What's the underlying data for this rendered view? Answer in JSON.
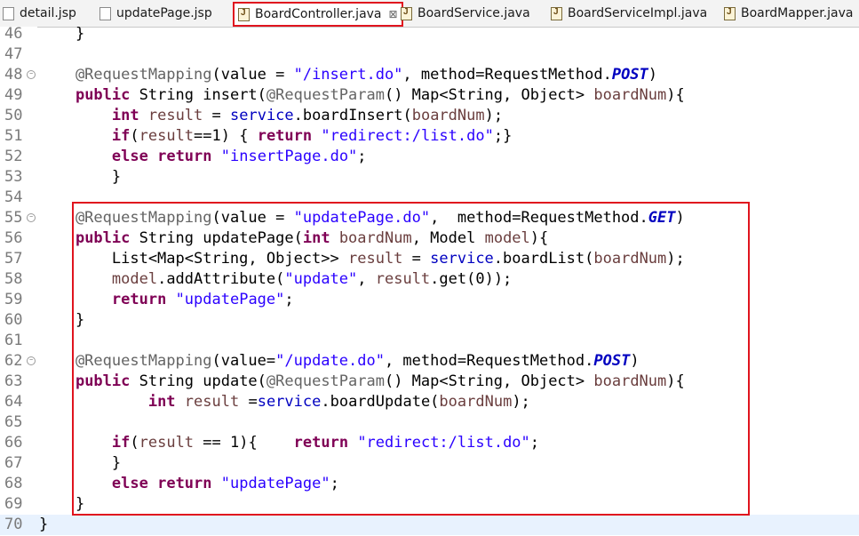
{
  "tabs": [
    {
      "label": "detail.jsp",
      "type": "jsp"
    },
    {
      "label": "updatePage.jsp",
      "type": "jsp"
    },
    {
      "label": "BoardController.java",
      "type": "java",
      "active": true,
      "close": "⊠"
    },
    {
      "label": "BoardService.java",
      "type": "java"
    },
    {
      "label": "BoardServiceImpl.java",
      "type": "java"
    },
    {
      "label": "BoardMapper.java",
      "type": "java"
    }
  ],
  "lines": [
    {
      "n": "46",
      "t": [
        [
          "    }",
          "p"
        ]
      ]
    },
    {
      "n": "47",
      "t": []
    },
    {
      "n": "48",
      "fold": true,
      "t": [
        [
          "    @RequestMapping",
          "ann"
        ],
        [
          "(value = ",
          "p"
        ],
        [
          "\"/insert.do\"",
          "str"
        ],
        [
          ", method=RequestMethod.",
          "p"
        ],
        [
          "POST",
          "cst"
        ],
        [
          ")",
          "p"
        ]
      ]
    },
    {
      "n": "49",
      "t": [
        [
          "    ",
          "p"
        ],
        [
          "public",
          "kw"
        ],
        [
          " String insert(",
          "p"
        ],
        [
          "@RequestParam",
          "ann"
        ],
        [
          "() Map<String, Object> ",
          "p"
        ],
        [
          "boardNum",
          "var"
        ],
        [
          "){",
          "p"
        ]
      ]
    },
    {
      "n": "50",
      "t": [
        [
          "        ",
          "p"
        ],
        [
          "int",
          "kw"
        ],
        [
          " ",
          "p"
        ],
        [
          "result",
          "var"
        ],
        [
          " = ",
          "p"
        ],
        [
          "service",
          "fld"
        ],
        [
          ".boardInsert(",
          "p"
        ],
        [
          "boardNum",
          "var"
        ],
        [
          ");",
          "p"
        ]
      ]
    },
    {
      "n": "51",
      "t": [
        [
          "        ",
          "p"
        ],
        [
          "if",
          "kw"
        ],
        [
          "(",
          "p"
        ],
        [
          "result",
          "var"
        ],
        [
          "==1) { ",
          "p"
        ],
        [
          "return",
          "kw"
        ],
        [
          " ",
          "p"
        ],
        [
          "\"redirect:/list.do\"",
          "str"
        ],
        [
          ";}",
          "p"
        ]
      ]
    },
    {
      "n": "52",
      "t": [
        [
          "        ",
          "p"
        ],
        [
          "else",
          "kw"
        ],
        [
          " ",
          "p"
        ],
        [
          "return",
          "kw"
        ],
        [
          " ",
          "p"
        ],
        [
          "\"insertPage.do\"",
          "str"
        ],
        [
          ";",
          "p"
        ]
      ]
    },
    {
      "n": "53",
      "t": [
        [
          "        }",
          "p"
        ]
      ]
    },
    {
      "n": "54",
      "t": []
    },
    {
      "n": "55",
      "fold": true,
      "t": [
        [
          "    @RequestMapping",
          "ann"
        ],
        [
          "(value = ",
          "p"
        ],
        [
          "\"updatePage.do\"",
          "str"
        ],
        [
          ",  method=RequestMethod.",
          "p"
        ],
        [
          "GET",
          "cst"
        ],
        [
          ")",
          "p"
        ]
      ]
    },
    {
      "n": "56",
      "t": [
        [
          "    ",
          "p"
        ],
        [
          "public",
          "kw"
        ],
        [
          " String updatePage(",
          "p"
        ],
        [
          "int",
          "kw"
        ],
        [
          " ",
          "p"
        ],
        [
          "boardNum",
          "var"
        ],
        [
          ", Model ",
          "p"
        ],
        [
          "model",
          "var"
        ],
        [
          "){",
          "p"
        ]
      ]
    },
    {
      "n": "57",
      "t": [
        [
          "        List<Map<String, Object>> ",
          "p"
        ],
        [
          "result",
          "var"
        ],
        [
          " = ",
          "p"
        ],
        [
          "service",
          "fld"
        ],
        [
          ".boardList(",
          "p"
        ],
        [
          "boardNum",
          "var"
        ],
        [
          ");",
          "p"
        ]
      ]
    },
    {
      "n": "58",
      "t": [
        [
          "        ",
          "p"
        ],
        [
          "model",
          "var"
        ],
        [
          ".addAttribute(",
          "p"
        ],
        [
          "\"update\"",
          "str"
        ],
        [
          ", ",
          "p"
        ],
        [
          "result",
          "var"
        ],
        [
          ".get(0));",
          "p"
        ]
      ]
    },
    {
      "n": "59",
      "t": [
        [
          "        ",
          "p"
        ],
        [
          "return",
          "kw"
        ],
        [
          " ",
          "p"
        ],
        [
          "\"updatePage\"",
          "str"
        ],
        [
          ";",
          "p"
        ]
      ]
    },
    {
      "n": "60",
      "t": [
        [
          "    }",
          "p"
        ]
      ]
    },
    {
      "n": "61",
      "t": []
    },
    {
      "n": "62",
      "fold": true,
      "t": [
        [
          "    @RequestMapping",
          "ann"
        ],
        [
          "(value=",
          "p"
        ],
        [
          "\"/update.do\"",
          "str"
        ],
        [
          ", method=RequestMethod.",
          "p"
        ],
        [
          "POST",
          "cst"
        ],
        [
          ")",
          "p"
        ]
      ]
    },
    {
      "n": "63",
      "t": [
        [
          "    ",
          "p"
        ],
        [
          "public",
          "kw"
        ],
        [
          " String update(",
          "p"
        ],
        [
          "@RequestParam",
          "ann"
        ],
        [
          "() Map<String, Object> ",
          "p"
        ],
        [
          "boardNum",
          "var"
        ],
        [
          "){",
          "p"
        ]
      ]
    },
    {
      "n": "64",
      "t": [
        [
          "            ",
          "p"
        ],
        [
          "int",
          "kw"
        ],
        [
          " ",
          "p"
        ],
        [
          "result",
          "var"
        ],
        [
          " =",
          "p"
        ],
        [
          "service",
          "fld"
        ],
        [
          ".boardUpdate(",
          "p"
        ],
        [
          "boardNum",
          "var"
        ],
        [
          ");",
          "p"
        ]
      ]
    },
    {
      "n": "65",
      "t": []
    },
    {
      "n": "66",
      "t": [
        [
          "        ",
          "p"
        ],
        [
          "if",
          "kw"
        ],
        [
          "(",
          "p"
        ],
        [
          "result",
          "var"
        ],
        [
          " == 1){    ",
          "p"
        ],
        [
          "return",
          "kw"
        ],
        [
          " ",
          "p"
        ],
        [
          "\"redirect:/list.do\"",
          "str"
        ],
        [
          ";",
          "p"
        ]
      ]
    },
    {
      "n": "67",
      "t": [
        [
          "        }",
          "p"
        ]
      ]
    },
    {
      "n": "68",
      "t": [
        [
          "        ",
          "p"
        ],
        [
          "else",
          "kw"
        ],
        [
          " ",
          "p"
        ],
        [
          "return",
          "kw"
        ],
        [
          " ",
          "p"
        ],
        [
          "\"updatePage\"",
          "str"
        ],
        [
          ";",
          "p"
        ]
      ]
    },
    {
      "n": "69",
      "t": [
        [
          "    }",
          "p"
        ]
      ]
    },
    {
      "n": "70",
      "cursor": true,
      "t": [
        [
          "}",
          "p"
        ]
      ]
    }
  ]
}
